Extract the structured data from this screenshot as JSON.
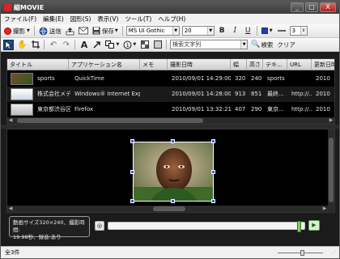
{
  "window": {
    "title": "MOVIE",
    "title_prefix": "縮",
    "minimize": "_",
    "maximize": "□",
    "close": "X"
  },
  "menu": [
    {
      "label": "ファイル(F)"
    },
    {
      "label": "編集(E)"
    },
    {
      "label": "図形(S)"
    },
    {
      "label": "表示(V)"
    },
    {
      "label": "ツール(T)"
    },
    {
      "label": "ヘルプ(H)"
    }
  ],
  "toolbar1": {
    "record_label": "撮影",
    "send_label": "送信",
    "save_label": "保存",
    "font_name": "MS UI Gothic",
    "font_size": "20",
    "bold": "B",
    "italic": "I",
    "underline": "U",
    "line_width": "3",
    "accent_color": "#1a3cc8"
  },
  "toolbar2": {
    "search_placeholder": "検索文字列",
    "search_label": "検索",
    "clear_label": "クリア"
  },
  "list": {
    "columns": [
      "タイトル",
      "アプリケーション名",
      "メモ",
      "撮影日時",
      "幅",
      "高さ",
      "テキ...",
      "URL",
      "更新日時"
    ],
    "rows": [
      {
        "title": "sports",
        "app": "QuickTime",
        "memo": "",
        "datetime": "2010/09/01 14:29:00",
        "width": "320",
        "height": "240",
        "text": "sports",
        "url": "",
        "updated": "2010",
        "thumb": "sports"
      },
      {
        "title": "株式会社メディ...",
        "app": "Windows® Internet Explorer",
        "memo": "",
        "datetime": "2010/09/01 14:28:00",
        "width": "913",
        "height": "851",
        "text": "最終...",
        "url": "http://...",
        "updated": "2010",
        "thumb": "web"
      },
      {
        "title": "東京都渋谷区...",
        "app": "Firefox",
        "memo": "",
        "datetime": "2010/09/01 13:32:21",
        "width": "407",
        "height": "290",
        "text": "東京...",
        "url": "http://...",
        "updated": "2010",
        "thumb": "map"
      }
    ]
  },
  "info": {
    "line1": "動画サイズ320×240、撮影時間:",
    "line2": "19.98秒、録音:あり"
  },
  "playback": {
    "progress": 0.985,
    "play_symbol": "▶",
    "snap_symbol": "◎"
  },
  "status": {
    "count_text": "全3件",
    "zoom_level": 0.55
  }
}
